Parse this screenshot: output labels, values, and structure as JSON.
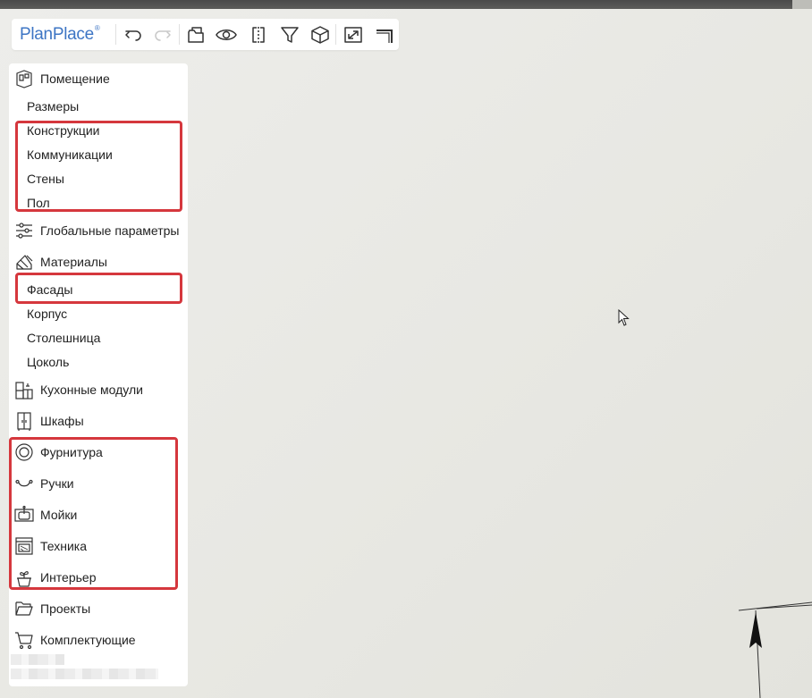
{
  "app": {
    "brand": "PlanPlace",
    "brand_mark": "®"
  },
  "toolbar": {
    "buttons": [
      {
        "name": "undo",
        "icon": "undo-icon"
      },
      {
        "name": "redo",
        "icon": "redo-icon"
      },
      {
        "name": "open",
        "icon": "open-icon"
      },
      {
        "name": "view",
        "icon": "eye-icon"
      },
      {
        "name": "mirror",
        "icon": "mirror-icon"
      },
      {
        "name": "filter",
        "icon": "filter-icon"
      },
      {
        "name": "3d",
        "icon": "cube-icon"
      },
      {
        "name": "fullscreen",
        "icon": "expand-icon"
      },
      {
        "name": "corner",
        "icon": "corner-icon"
      }
    ]
  },
  "sidebar": {
    "room": {
      "label": "Помещение",
      "icon": "room-plan-icon",
      "subitems": [
        "Размеры",
        "Конструкции",
        "Коммуникации",
        "Стены",
        "Пол"
      ]
    },
    "global_params": {
      "label": "Глобальные параметры",
      "icon": "sliders-icon"
    },
    "materials": {
      "label": "Материалы",
      "icon": "materials-icon",
      "subitems": [
        "Фасады",
        "Корпус",
        "Столешница",
        "Цоколь"
      ]
    },
    "kitchen_modules": {
      "label": "Кухонные модули",
      "icon": "kitchen-modules-icon"
    },
    "cabinets": {
      "label": "Шкафы",
      "icon": "cabinet-icon"
    },
    "fittings": {
      "label": "Фурнитура",
      "icon": "fittings-icon"
    },
    "handles": {
      "label": "Ручки",
      "icon": "handle-icon"
    },
    "sinks": {
      "label": "Мойки",
      "icon": "sink-icon"
    },
    "appliances": {
      "label": "Техника",
      "icon": "oven-icon"
    },
    "interior": {
      "label": "Интерьер",
      "icon": "plant-pot-icon"
    },
    "projects": {
      "label": "Проекты",
      "icon": "folder-icon"
    },
    "components": {
      "label": "Комплектующие",
      "icon": "cart-icon"
    }
  },
  "colors": {
    "brand_blue": "#3d75c4",
    "highlight_red": "#d5373d",
    "canvas_bg": "#e9e9e5"
  }
}
